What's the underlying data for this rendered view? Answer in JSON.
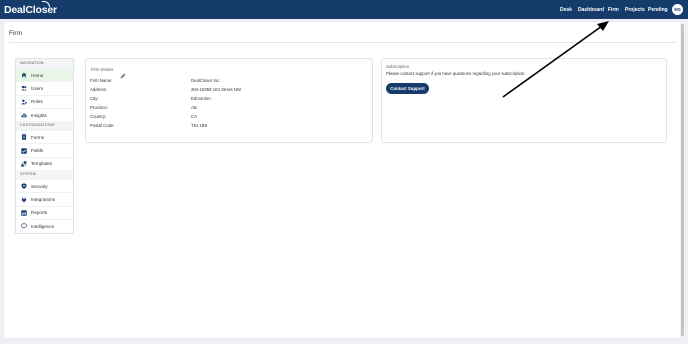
{
  "brand": {
    "name": "DealCloser",
    "bg": "#163c6b",
    "accent": "#163c6b"
  },
  "topnav": {
    "items": [
      "Desk",
      "Dashboard",
      "Firm",
      "Projects",
      "Pending"
    ],
    "avatar": "MS"
  },
  "page": {
    "title": "Firm"
  },
  "sidebar": {
    "sections": [
      {
        "label": "NAVIGATION",
        "items": [
          {
            "label": "Home",
            "icon": "home-icon",
            "active": true
          },
          {
            "label": "Users",
            "icon": "users-icon"
          },
          {
            "label": "Roles",
            "icon": "roles-icon"
          },
          {
            "label": "Insights",
            "icon": "insights-icon"
          }
        ]
      },
      {
        "label": "CUSTOMIZATIONS",
        "items": [
          {
            "label": "Forms",
            "icon": "forms-icon"
          },
          {
            "label": "Fields",
            "icon": "fields-icon"
          },
          {
            "label": "Templates",
            "icon": "templates-icon"
          }
        ]
      },
      {
        "label": "SYSTEM",
        "items": [
          {
            "label": "Security",
            "icon": "security-icon"
          },
          {
            "label": "Integrations",
            "icon": "integrations-icon"
          },
          {
            "label": "Reports",
            "icon": "reports-icon"
          },
          {
            "label": "Intelligence",
            "icon": "intelligence-icon"
          }
        ]
      }
    ]
  },
  "firm_details": {
    "label": "Firm Details",
    "rows": [
      {
        "key": "Firm Name:",
        "value": "DealCloser Inc."
      },
      {
        "key": "Address:",
        "value": "204-10359 104 Street NW"
      },
      {
        "key": "City:",
        "value": "Edmonton"
      },
      {
        "key": "Province:",
        "value": "AB"
      },
      {
        "key": "Country:",
        "value": "CA"
      },
      {
        "key": "Postal Code:",
        "value": "T5J 1B9"
      }
    ]
  },
  "subscription": {
    "label": "Subscription",
    "text": "Please contact support if you have questions regarding your subscription.",
    "button": "Contact Support"
  }
}
